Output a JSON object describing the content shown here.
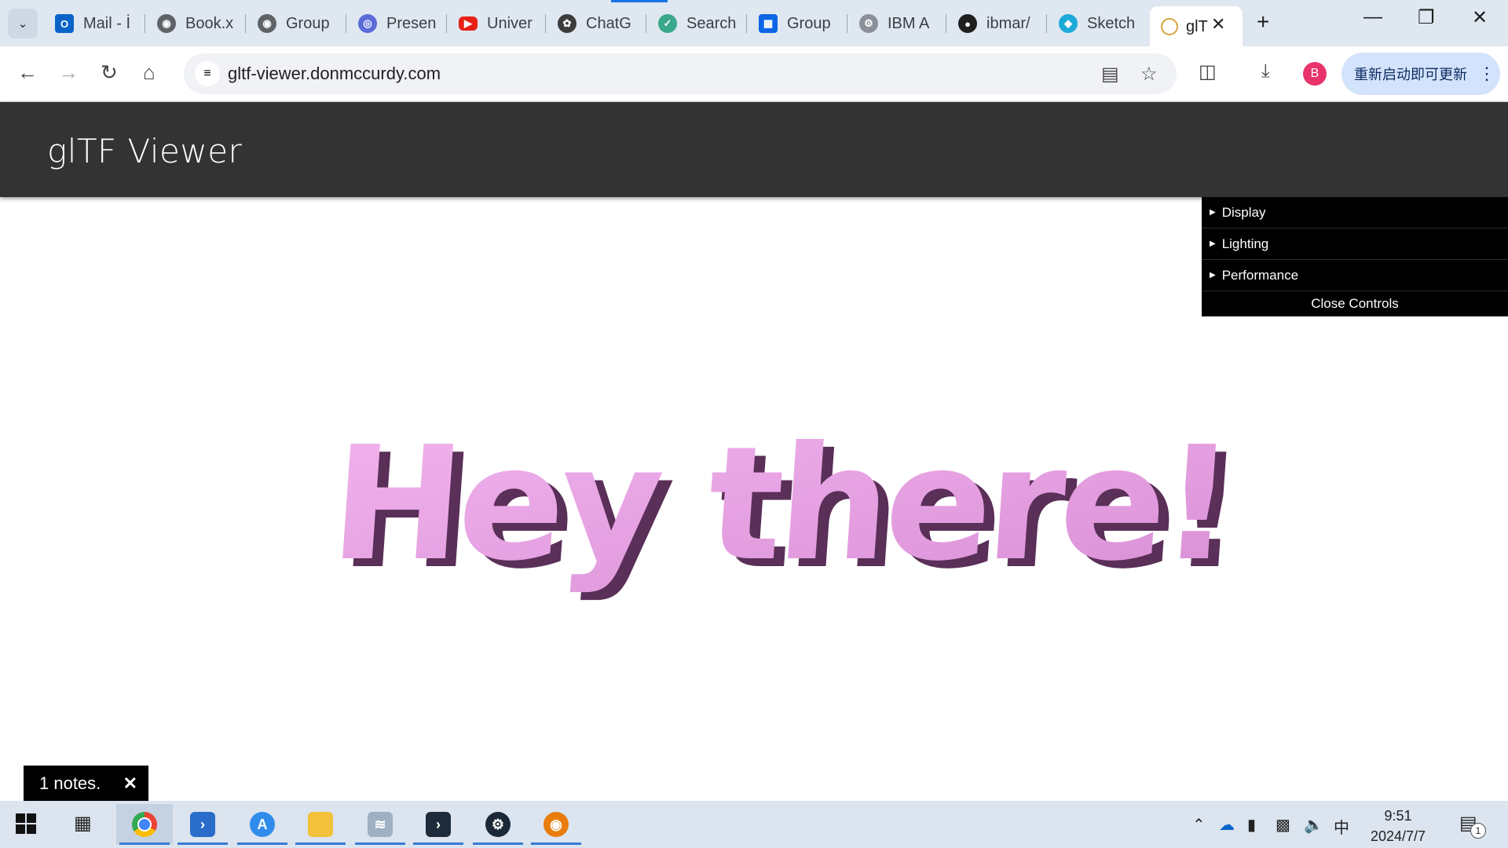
{
  "browser": {
    "tabs": [
      {
        "label": "Mail - İ",
        "icon": "outlook-icon",
        "color": "#0a64c8"
      },
      {
        "label": "Book.x",
        "icon": "globe-icon",
        "color": "#5f6368"
      },
      {
        "label": "Group",
        "icon": "globe-icon",
        "color": "#5f6368"
      },
      {
        "label": "Presen",
        "icon": "presentation-icon",
        "color": "#5b6bd8"
      },
      {
        "label": "Univer",
        "icon": "youtube-icon",
        "color": "#e62117"
      },
      {
        "label": "ChatG",
        "icon": "openai-icon",
        "color": "#3c3c3c"
      },
      {
        "label": "Search",
        "icon": "search-site-icon",
        "color": "#3aa88a"
      },
      {
        "label": "Group",
        "icon": "trello-icon",
        "color": "#0c66e4"
      },
      {
        "label": "IBM A",
        "icon": "ibm-icon",
        "color": "#8a8f98"
      },
      {
        "label": "ibmar/",
        "icon": "github-icon",
        "color": "#1f1f1f"
      },
      {
        "label": "Sketch",
        "icon": "sketchfab-icon",
        "color": "#1caad9"
      }
    ],
    "active_tab": {
      "label": "glT",
      "icon": "gltf-icon"
    },
    "url": "gltf-viewer.donmccurdy.com",
    "update_label": "重新启动即可更新",
    "profile_initial": "B"
  },
  "app": {
    "title": "glTF Viewer",
    "model_text": "Hey there!",
    "controls": {
      "folders": [
        "Display",
        "Lighting",
        "Performance"
      ],
      "close_label": "Close Controls"
    },
    "notes": {
      "label": "1 notes."
    }
  },
  "taskbar": {
    "apps": [
      {
        "name": "chrome",
        "icon": "chrome-icon",
        "active": true
      },
      {
        "name": "powershell",
        "icon": "powershell-icon",
        "active": false
      },
      {
        "name": "app-store",
        "icon": "app-store-icon",
        "active": false
      },
      {
        "name": "file-explorer",
        "icon": "folder-icon",
        "active": false
      },
      {
        "name": "resource-monitor",
        "icon": "monitor-icon",
        "active": false
      },
      {
        "name": "dev-tool",
        "icon": "terminal-icon",
        "active": false
      },
      {
        "name": "steam",
        "icon": "steam-icon",
        "active": false
      },
      {
        "name": "blender",
        "icon": "blender-icon",
        "active": false
      }
    ],
    "tray": {
      "ime": "中",
      "notification_count": "1"
    },
    "clock": {
      "time": "9:51",
      "date": "2024/7/7"
    }
  }
}
